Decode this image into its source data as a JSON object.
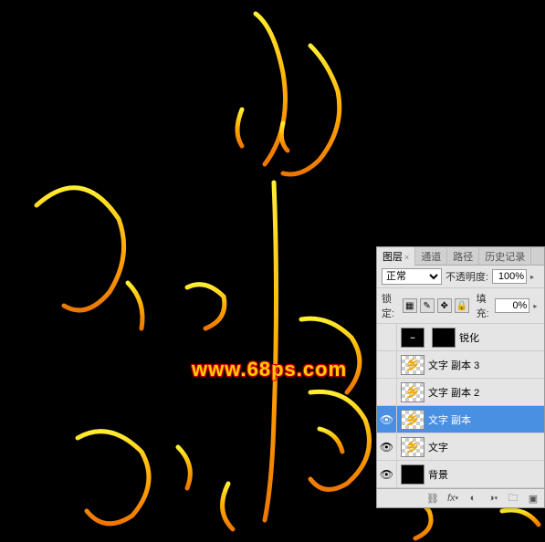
{
  "watermark": "www.68ps.com",
  "panel": {
    "tabs": {
      "layers": "图层",
      "channels": "通道",
      "paths": "路径",
      "history": "历史记录"
    },
    "blend_mode": "正常",
    "opacity_label": "不透明度:",
    "opacity_value": "100%",
    "lock_label": "锁定:",
    "fill_label": "填充:",
    "fill_value": "0%",
    "layers": [
      {
        "visible": false,
        "name": "锐化",
        "thumb": "black"
      },
      {
        "visible": false,
        "name": "文字 副本 3",
        "thumb": "checker"
      },
      {
        "visible": false,
        "name": "文字 副本 2",
        "thumb": "checker"
      },
      {
        "visible": true,
        "name": "文字 副本",
        "thumb": "checker",
        "selected": true
      },
      {
        "visible": true,
        "name": "文字",
        "thumb": "checker"
      },
      {
        "visible": true,
        "name": "背景",
        "thumb": "black"
      }
    ]
  }
}
